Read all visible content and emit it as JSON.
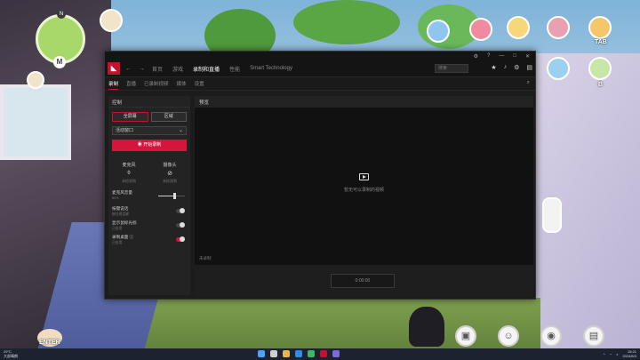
{
  "hud": {
    "north_marker": "N",
    "map_marker": "M",
    "tab_label": "TAB",
    "b_label": "B",
    "enter_label": "ENTER"
  },
  "app": {
    "nav": {
      "items": [
        "首页",
        "游戏",
        "录制和直播",
        "性能",
        "Smart Technology"
      ],
      "active_index": 2,
      "search_placeholder": "搜索"
    },
    "subnav": {
      "items": [
        "录制",
        "直播",
        "已录制视频",
        "媒体",
        "设置"
      ],
      "active_index": 0
    },
    "panel": {
      "header": "控制",
      "mode_fullscreen": "全屏幕",
      "mode_region": "区域",
      "dropdown_value": "活动窗口",
      "record_button": "开始录制",
      "mic": {
        "label": "麦克风",
        "status": "未检测到"
      },
      "camera": {
        "label": "摄像头",
        "status": "未检测到"
      },
      "mic_volume": {
        "label": "麦克风音量",
        "value_text": "80%",
        "value": 0.6
      },
      "toggles": [
        {
          "label": "按键说话",
          "sub": "按住说话键",
          "on": false
        },
        {
          "label": "显示鼠标光标",
          "sub": "已启用",
          "on": false
        },
        {
          "label": "录制桌面",
          "sub": "已启用",
          "on": true
        }
      ]
    },
    "preview": {
      "header": "预览",
      "message": "暂无可以录制的视频",
      "footer": "未录制",
      "time": "0:00:00"
    }
  },
  "taskbar": {
    "weather": "29°C",
    "weather_sub": "大部晴朗",
    "clock_time": "15:21",
    "clock_date": "2024/8/3"
  }
}
